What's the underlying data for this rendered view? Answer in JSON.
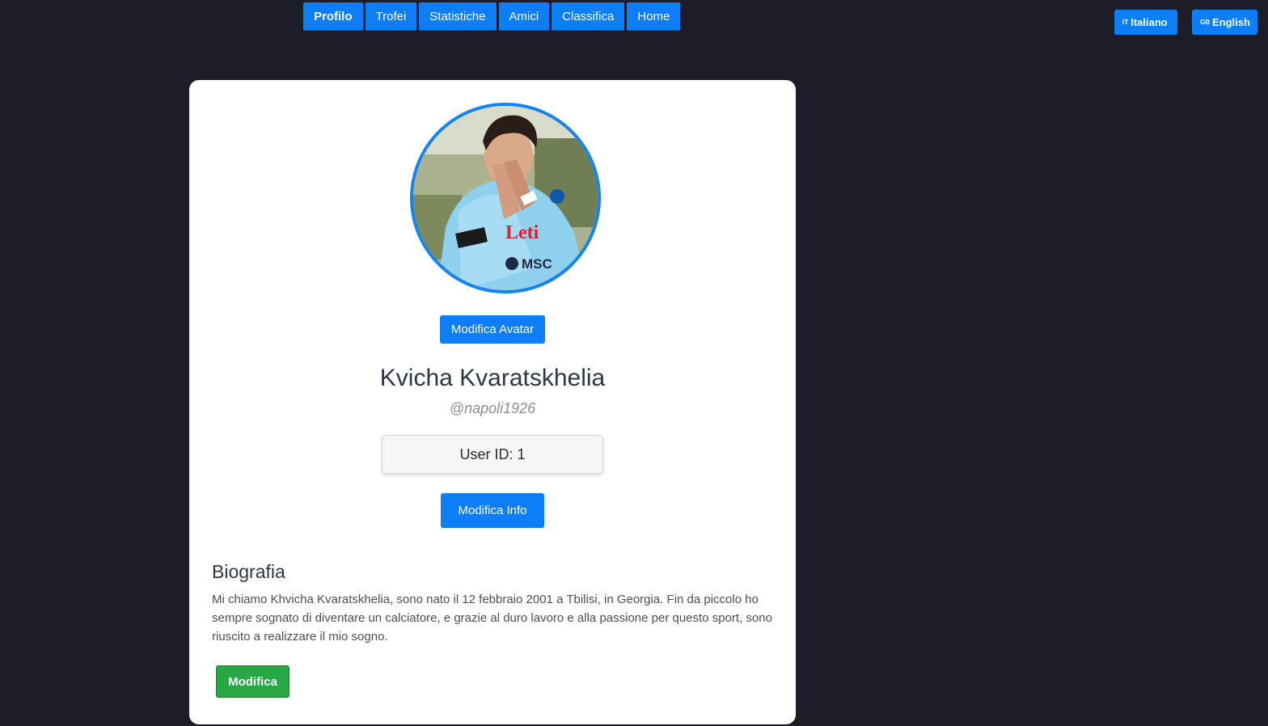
{
  "nav": {
    "items": [
      {
        "label": "Profilo",
        "active": true
      },
      {
        "label": "Trofei"
      },
      {
        "label": "Statistiche"
      },
      {
        "label": "Amici"
      },
      {
        "label": "Classifica"
      },
      {
        "label": "Home"
      }
    ]
  },
  "languages": {
    "it": {
      "flag": "IT",
      "label": "Italiano"
    },
    "en": {
      "flag": "GB",
      "label": "English"
    }
  },
  "profile": {
    "avatar_button": "Modifica Avatar",
    "name": "Kvicha Kvaratskhelia",
    "handle": "@napoli1926",
    "user_id": "User ID: 1",
    "info_button": "Modifica Info",
    "jersey_text": "Leti",
    "jersey_sponsor": "MSC"
  },
  "bio": {
    "title": "Biografia",
    "text": "Mi chiamo Khvicha Kvaratskhelia, sono nato il 12 febbraio 2001 a Tbilisi, in Georgia. Fin da piccolo ho sempre sognato di diventare un calciatore, e grazie al duro lavoro e alla passione per questo sport, sono riuscito a realizzare il mio sogno.",
    "edit_button": "Modifica"
  },
  "colors": {
    "background": "#1c1d29",
    "primary": "#0d7ef5",
    "success": "#28a745"
  }
}
